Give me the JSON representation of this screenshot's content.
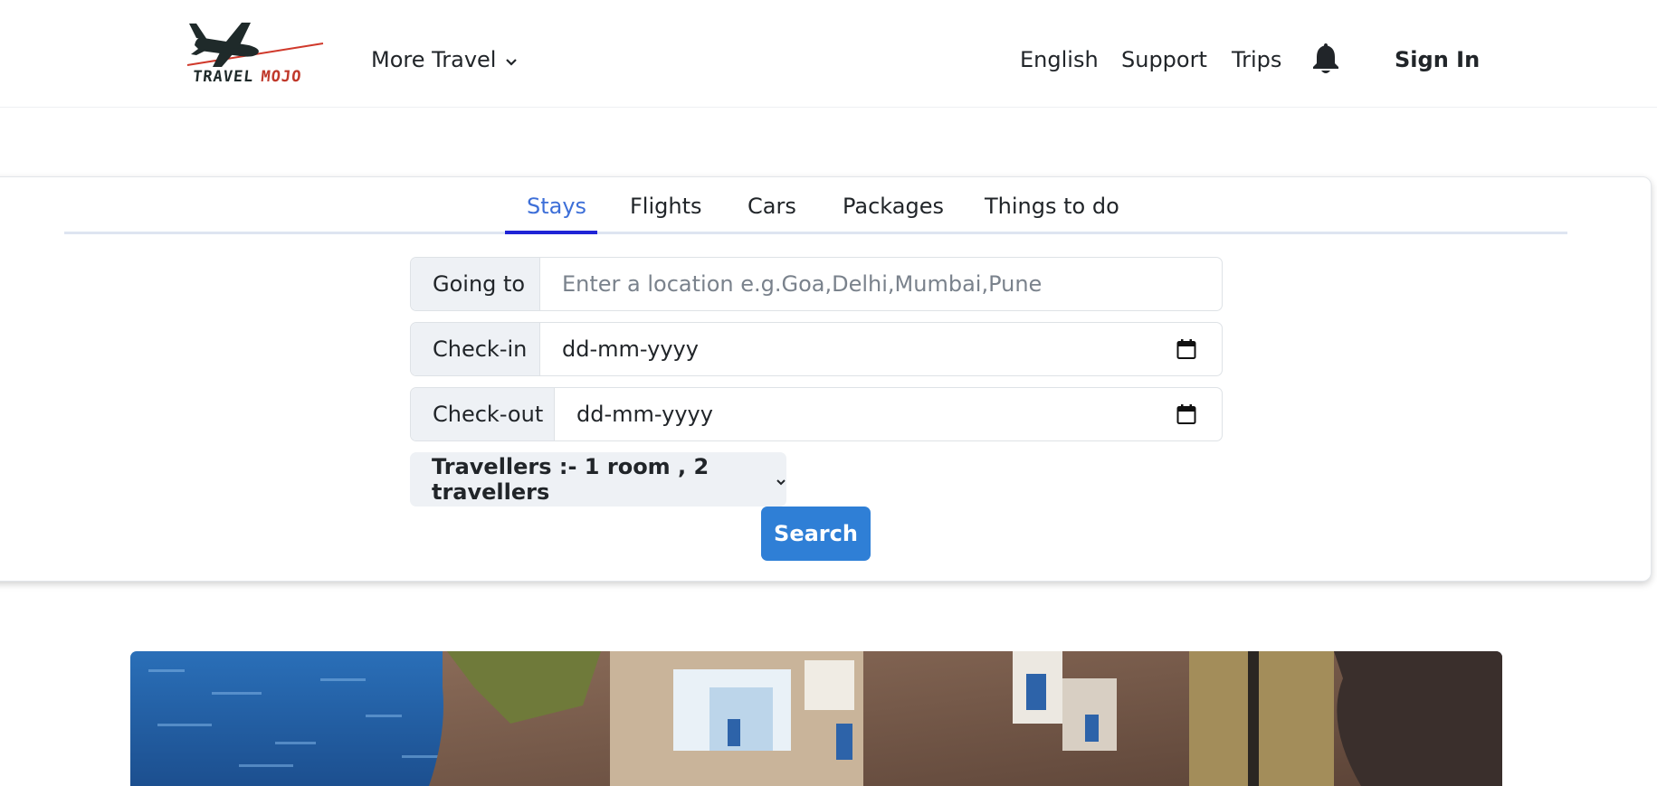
{
  "header": {
    "logo": {
      "text_left": "TRAVEL",
      "text_right": "MOJO"
    },
    "more_travel": "More Travel",
    "links": [
      "English",
      "Support",
      "Trips"
    ],
    "notification_icon": "bell-icon",
    "sign_in": "Sign In"
  },
  "search": {
    "tabs": [
      {
        "label": "Stays",
        "active": true
      },
      {
        "label": "Flights",
        "active": false
      },
      {
        "label": "Cars",
        "active": false
      },
      {
        "label": "Packages",
        "active": false
      },
      {
        "label": "Things to do",
        "active": false
      }
    ],
    "going_to": {
      "label": "Going to",
      "placeholder": "Enter a location e.g.Goa,Delhi,Mumbai,Pune"
    },
    "check_in": {
      "label": "Check-in",
      "value": "dd-mm-yyyy",
      "icon": "calendar-icon"
    },
    "check_out": {
      "label": "Check-out",
      "value": "dd-mm-yyyy",
      "icon": "calendar-icon"
    },
    "travellers": "Travellers :- 1 room , 2 travellers",
    "button": "Search"
  },
  "colors": {
    "accent": "#2f7fd6",
    "active_tab": "#3d6fd8",
    "tab_underline": "#1f24d6",
    "logo_red": "#c0392b"
  }
}
